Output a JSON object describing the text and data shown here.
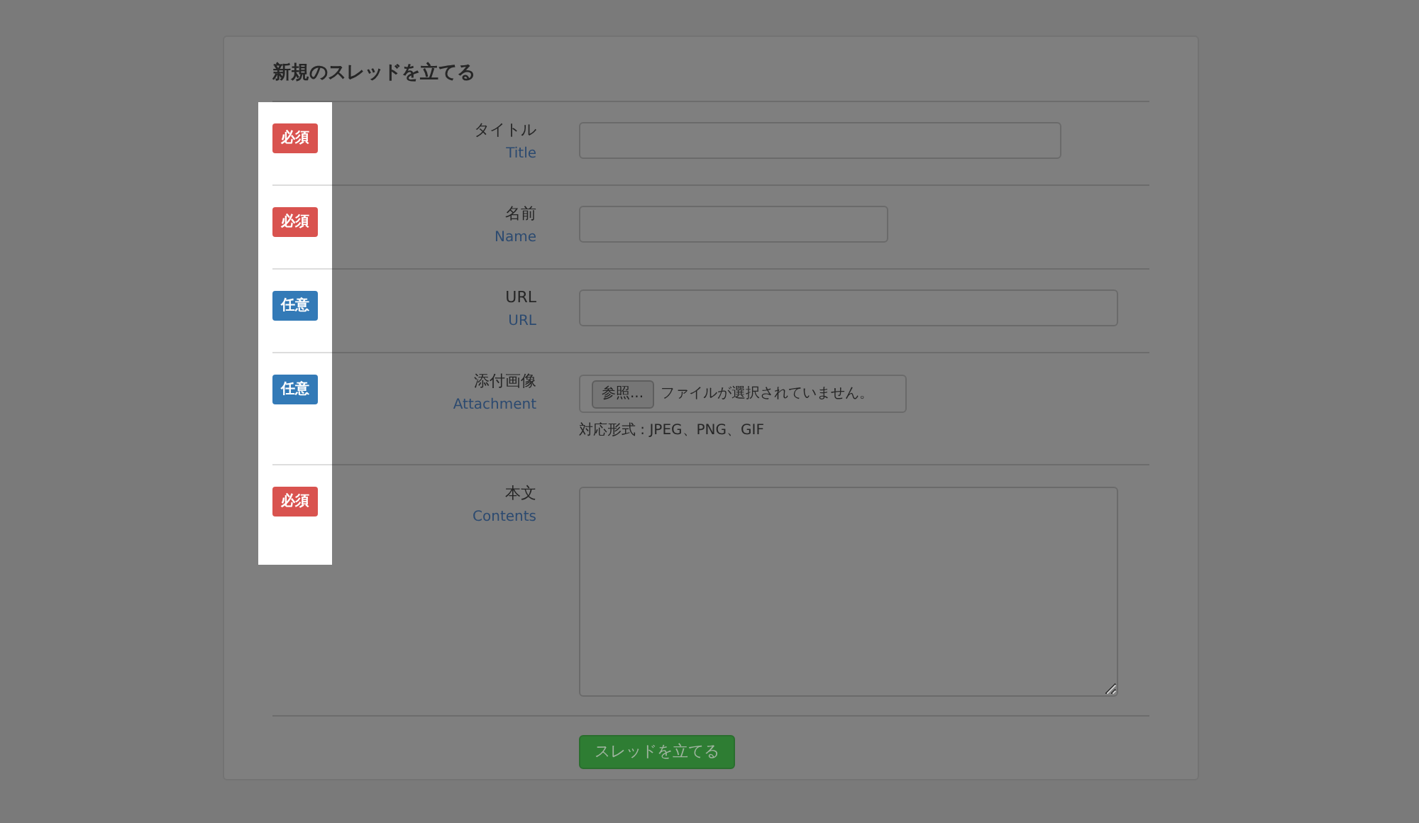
{
  "title": "新規のスレッドを立てる",
  "fields": [
    {
      "kind": "text",
      "required": true,
      "badge": "必須",
      "label": "タイトル",
      "sublabel": "Title"
    },
    {
      "kind": "text",
      "required": true,
      "badge": "必須",
      "label": "名前",
      "sublabel": "Name"
    },
    {
      "kind": "text",
      "required": false,
      "badge": "任意",
      "label": "URL",
      "sublabel": "URL"
    },
    {
      "kind": "file",
      "required": false,
      "badge": "任意",
      "label": "添付画像",
      "sublabel": "Attachment",
      "button": "参照...",
      "status": "ファイルが選択されていません。",
      "note": "対応形式 : JPEG、PNG、GIF"
    },
    {
      "kind": "textarea",
      "required": true,
      "badge": "必須",
      "label": "本文",
      "sublabel": "Contents"
    }
  ],
  "submit": "スレッドを立てる"
}
